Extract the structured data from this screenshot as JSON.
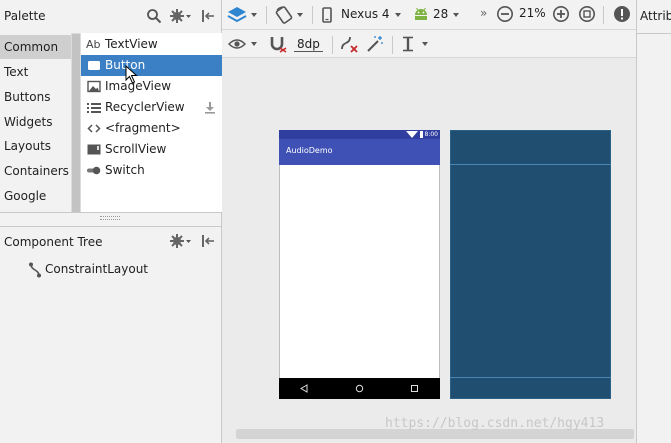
{
  "palette": {
    "title": "Palette",
    "categories": [
      {
        "label": "Common",
        "selected": true
      },
      {
        "label": "Text"
      },
      {
        "label": "Buttons"
      },
      {
        "label": "Widgets"
      },
      {
        "label": "Layouts"
      },
      {
        "label": "Containers"
      },
      {
        "label": "Google"
      }
    ],
    "widgets": [
      {
        "label": "TextView",
        "icon": "text-view-icon",
        "prefix": "Ab"
      },
      {
        "label": "Button",
        "icon": "button-icon",
        "selected": true
      },
      {
        "label": "ImageView",
        "icon": "image-icon"
      },
      {
        "label": "RecyclerView",
        "icon": "list-icon"
      },
      {
        "label": "<fragment>",
        "icon": "code-brackets-icon"
      },
      {
        "label": "ScrollView",
        "icon": "scroll-view-icon"
      },
      {
        "label": "Switch",
        "icon": "switch-icon"
      }
    ]
  },
  "component_tree": {
    "title": "Component Tree",
    "root": "ConstraintLayout"
  },
  "toolbar": {
    "device": "Nexus 4",
    "api": "28",
    "zoom": "21%",
    "margin": "8dp"
  },
  "attributes": {
    "title": "Attrib"
  },
  "preview": {
    "app_title": "AudioDemo",
    "status_time": "8:00"
  },
  "watermark": "https://blog.csdn.net/hgy413",
  "colors": {
    "selection": "#3b7fc4",
    "app_bar": "#3f51b5",
    "status_bar": "#303f9f",
    "blueprint": "#1f4e70",
    "layers_icon": "#2f86d0"
  }
}
